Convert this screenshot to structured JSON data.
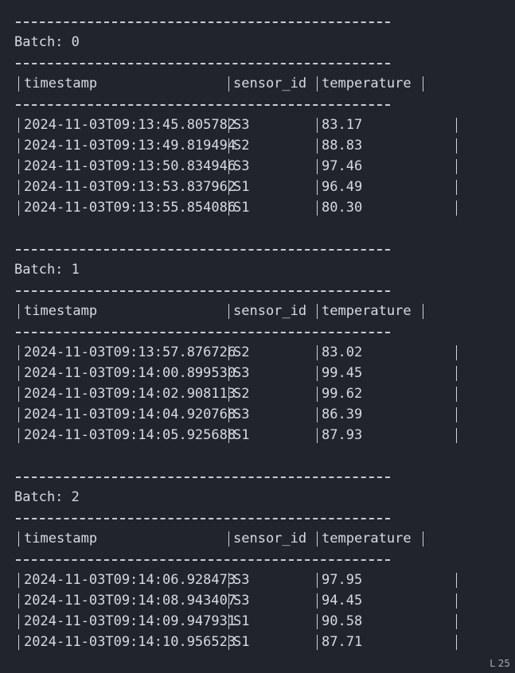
{
  "header": {
    "ts": "timestamp",
    "sid": "sensor_id",
    "tmp": "temperature"
  },
  "batches": [
    {
      "label": "Batch: 0",
      "rows": [
        {
          "ts": "2024-11-03T09:13:45.805782",
          "sid": "S3",
          "tmp": "83.17"
        },
        {
          "ts": "2024-11-03T09:13:49.819494",
          "sid": "S2",
          "tmp": "88.83"
        },
        {
          "ts": "2024-11-03T09:13:50.834946",
          "sid": "S3",
          "tmp": "97.46"
        },
        {
          "ts": "2024-11-03T09:13:53.837962",
          "sid": "S1",
          "tmp": "96.49"
        },
        {
          "ts": "2024-11-03T09:13:55.854086",
          "sid": "S1",
          "tmp": "80.30"
        }
      ]
    },
    {
      "label": "Batch: 1",
      "rows": [
        {
          "ts": "2024-11-03T09:13:57.876726",
          "sid": "S2",
          "tmp": "83.02"
        },
        {
          "ts": "2024-11-03T09:14:00.899530",
          "sid": "S3",
          "tmp": "99.45"
        },
        {
          "ts": "2024-11-03T09:14:02.908113",
          "sid": "S2",
          "tmp": "99.62"
        },
        {
          "ts": "2024-11-03T09:14:04.920768",
          "sid": "S3",
          "tmp": "86.39"
        },
        {
          "ts": "2024-11-03T09:14:05.925688",
          "sid": "S1",
          "tmp": "87.93"
        }
      ]
    },
    {
      "label": "Batch: 2",
      "rows": [
        {
          "ts": "2024-11-03T09:14:06.928473",
          "sid": "S3",
          "tmp": "97.95"
        },
        {
          "ts": "2024-11-03T09:14:08.943407",
          "sid": "S3",
          "tmp": "94.45"
        },
        {
          "ts": "2024-11-03T09:14:09.947931",
          "sid": "S1",
          "tmp": "90.58"
        },
        {
          "ts": "2024-11-03T09:14:10.956523",
          "sid": "S1",
          "tmp": "87.71"
        }
      ]
    }
  ],
  "corner_text": "L 25"
}
